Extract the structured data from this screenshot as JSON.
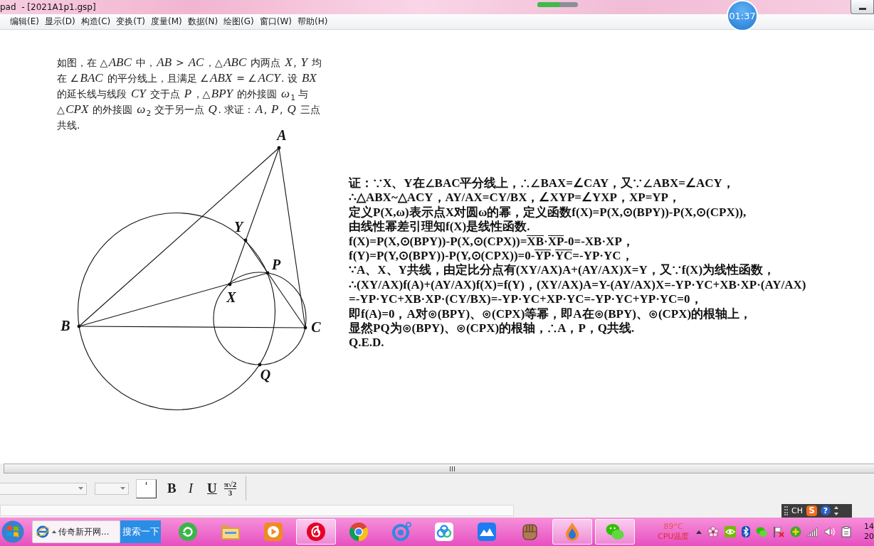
{
  "title_bar": {
    "title": "pad  - [2021A1p1.gsp]",
    "progress": {
      "level": 0.55
    }
  },
  "timer": {
    "time": "01:37"
  },
  "menu_bar": {
    "items": [
      "编辑(E)",
      "显示(D)",
      "构造(C)",
      "变换(T)",
      "度量(M)",
      "数据(N)",
      "绘图(G)",
      "窗口(W)",
      "帮助(H)"
    ]
  },
  "problem": {
    "text": "如图，在 △*ABC* 中，*AB* > *AC*，△*ABC* 内两点 *X*, *Y* 均在 ∠*BAC* 的平分线上，且满足 ∠*ABX* = ∠*ACY*. 设 *BX* 的延长线与线段 *CY* 交于点 *P*，△*BPY* 的外接圆 *ω*$_{1}$ 与 △*CPX* 的外接圆 *ω*$_{2}$ 交于另一点 *Q*. 求证：*A*, *P*, *Q* 三点共线."
  },
  "figure": {
    "points": [
      "A",
      "B",
      "C",
      "Y",
      "P",
      "X",
      "Q"
    ]
  },
  "proof": {
    "lines": [
      {
        "segments": [
          {
            "text": "证：∵X、Y在∠BAC平分线上，∴∠BAX=∠CAY，又∵∠ABX=∠ACY，",
            "overline": false
          }
        ]
      },
      {
        "segments": [
          {
            "text": "∴△ABX~△ACY，AY/AX=CY/BX，∠XYP=∠YXP，XP=YP，",
            "overline": false
          }
        ]
      },
      {
        "segments": [
          {
            "text": "定义P(X,ω)表示点X对圆ω的幂，定义函数f(X)=P(X,⊙(BPY))-P(X,⊙(CPX)),",
            "overline": false
          }
        ]
      },
      {
        "segments": [
          {
            "text": "由线性幂差引理知f(X)是线性函数.",
            "overline": false
          }
        ]
      },
      {
        "segments": [
          {
            "text": "f(X)=P(X,⊙(BPY))-P(X,⊙(CPX))=",
            "overline": false
          },
          {
            "text": "XB",
            "overline": true
          },
          {
            "text": "·",
            "overline": false
          },
          {
            "text": "XP",
            "overline": true
          },
          {
            "text": "-0=-XB·XP，",
            "overline": false
          }
        ]
      },
      {
        "segments": [
          {
            "text": "f(Y)=P(Y,⊙(BPY))-P(Y,⊙(CPX))=0-",
            "overline": false
          },
          {
            "text": "YP",
            "overline": true
          },
          {
            "text": "·",
            "overline": false
          },
          {
            "text": "YC",
            "overline": true
          },
          {
            "text": "=-YP·YC，",
            "overline": false
          }
        ]
      },
      {
        "segments": [
          {
            "text": "∵A、X、Y共线，由定比分点有(XY/AX)A+(AY/AX)X=Y，又∵f(X)为线性函数，",
            "overline": false
          }
        ]
      },
      {
        "segments": [
          {
            "text": "∴(XY/AX)f(A)+(AY/AX)f(X)=f(Y)，(XY/AX)A=Y-(AY/AX)X=-YP·YC+XB·XP·(AY/AX)",
            "overline": false
          }
        ]
      },
      {
        "segments": [
          {
            "text": "=-YP·YC+XB·XP·(CY/BX)=-YP·YC+XP·YC=-YP·YC+YP·YC=0，",
            "overline": false
          }
        ]
      },
      {
        "segments": [
          {
            "text": "即f(A)=0，A对⊙(BPY)、⊙(CPX)等幂，即A在⊙(BPY)、⊙(CPX)的根轴上，",
            "overline": false
          }
        ]
      },
      {
        "segments": [
          {
            "text": "显然PQ为⊙(BPY)、⊙(CPX)的根轴，∴A，P，Q共线.",
            "overline": false
          }
        ]
      },
      {
        "segments": [
          {
            "text": "Q.E.D.",
            "overline": false
          }
        ]
      }
    ]
  },
  "text_toolbar": {
    "buttons": [
      {
        "kind": "bold",
        "label": "B"
      },
      {
        "kind": "italic",
        "label": "I"
      },
      {
        "kind": "underline",
        "label": "U"
      },
      {
        "kind": "fraction",
        "numerator": "π√2",
        "denominator": "3"
      }
    ]
  },
  "language_bar": {
    "language": "CH",
    "ime_logo": "S",
    "help": "?"
  },
  "taskbar": {
    "window": {
      "title": "传奇新开网..."
    },
    "search_button": "搜索一下",
    "apps": [
      {
        "kind": "refresh",
        "active": false
      },
      {
        "kind": "folder",
        "active": false
      },
      {
        "kind": "player",
        "active": false
      },
      {
        "kind": "music",
        "active": true
      },
      {
        "kind": "browser",
        "active": false
      },
      {
        "kind": "ring",
        "active": false
      },
      {
        "kind": "cloud",
        "active": false
      },
      {
        "kind": "mountain",
        "active": false
      },
      {
        "kind": "glove",
        "active": false
      },
      {
        "kind": "flame",
        "active": true
      },
      {
        "kind": "chat",
        "active": true
      }
    ],
    "cpu": {
      "temperature": "89°C",
      "label": "CPU温度"
    },
    "clock": [
      "14",
      "20"
    ]
  }
}
